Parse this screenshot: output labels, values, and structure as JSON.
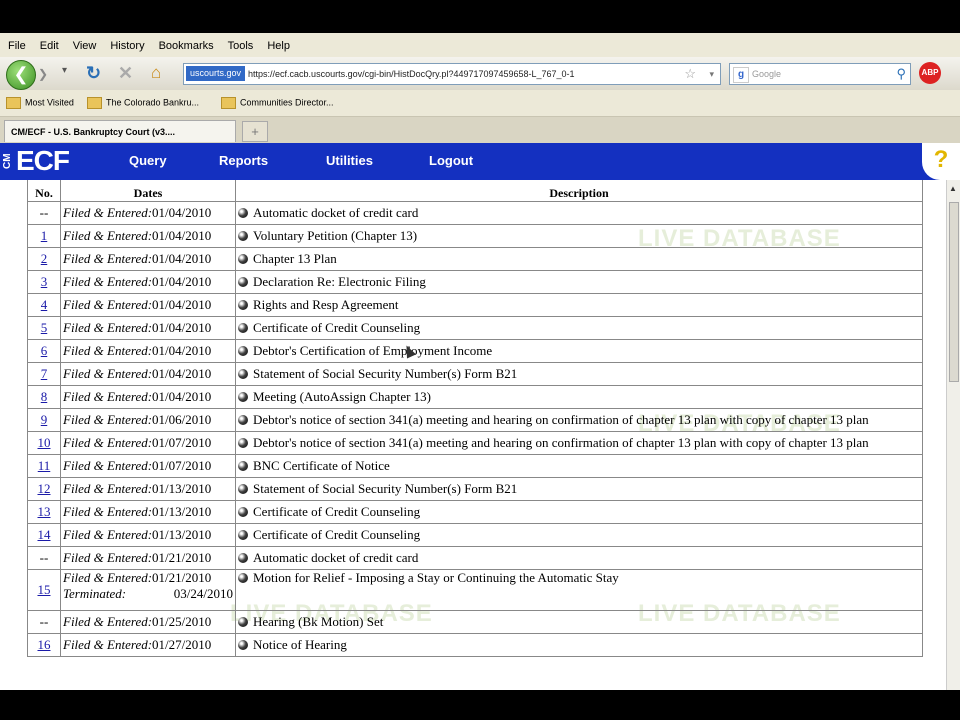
{
  "menu": [
    "File",
    "Edit",
    "View",
    "History",
    "Bookmarks",
    "Tools",
    "Help"
  ],
  "nav": {
    "back_icon": "back-arrow",
    "url_site": "uscourts.gov",
    "url": "https://ecf.cacb.uscourts.gov/cgi-bin/HistDocQry.pl?449717097459658-L_767_0-1",
    "search_placeholder": "Google",
    "adblock": "ABP"
  },
  "bookmarks": [
    "Most Visited",
    "The Colorado Bankru...",
    "Communities Director..."
  ],
  "tab": {
    "title": "CM/ECF - U.S. Bankruptcy Court (v3...."
  },
  "ecf": {
    "logo_cm": "CM",
    "logo_ecf": "ECF",
    "links": [
      "Query",
      "Reports",
      "Utilities",
      "Logout"
    ],
    "help": "?"
  },
  "watermark": "LIVE DATABASE",
  "table": {
    "headers": {
      "no": "No.",
      "dates": "Dates",
      "desc": "Description"
    },
    "filed_label": "Filed & Entered:",
    "terminated_label": "Terminated:",
    "rows": [
      {
        "no": "--",
        "date": "01/04/2010",
        "desc": "Automatic docket of credit card"
      },
      {
        "no": "1",
        "date": "01/04/2010",
        "desc": "Voluntary Petition (Chapter 13)"
      },
      {
        "no": "2",
        "date": "01/04/2010",
        "desc": "Chapter 13 Plan"
      },
      {
        "no": "3",
        "date": "01/04/2010",
        "desc": "Declaration Re: Electronic Filing"
      },
      {
        "no": "4",
        "date": "01/04/2010",
        "desc": "Rights and Resp Agreement"
      },
      {
        "no": "5",
        "date": "01/04/2010",
        "desc": "Certificate of Credit Counseling"
      },
      {
        "no": "6",
        "date": "01/04/2010",
        "desc": "Debtor's Certification of Employment Income"
      },
      {
        "no": "7",
        "date": "01/04/2010",
        "desc": "Statement of Social Security Number(s) Form B21"
      },
      {
        "no": "8",
        "date": "01/04/2010",
        "desc": "Meeting (AutoAssign Chapter 13)"
      },
      {
        "no": "9",
        "date": "01/06/2010",
        "desc": "Debtor's notice of section 341(a) meeting and hearing on confirmation of chapter 13 plan with copy of chapter 13 plan"
      },
      {
        "no": "10",
        "date": "01/07/2010",
        "desc": "Debtor's notice of section 341(a) meeting and hearing on confirmation of chapter 13 plan with copy of chapter 13 plan"
      },
      {
        "no": "11",
        "date": "01/07/2010",
        "desc": "BNC Certificate of Notice"
      },
      {
        "no": "12",
        "date": "01/13/2010",
        "desc": "Statement of Social Security Number(s) Form B21"
      },
      {
        "no": "13",
        "date": "01/13/2010",
        "desc": "Certificate of Credit Counseling"
      },
      {
        "no": "14",
        "date": "01/13/2010",
        "desc": "Certificate of Credit Counseling"
      },
      {
        "no": "--",
        "date": "01/21/2010",
        "desc": "Automatic docket of credit card"
      },
      {
        "no": "15",
        "date": "01/21/2010",
        "desc": "Motion for Relief - Imposing a Stay or Continuing the Automatic Stay",
        "terminated": "03/24/2010"
      },
      {
        "no": "--",
        "date": "01/25/2010",
        "desc": "Hearing (Bk Motion) Set"
      },
      {
        "no": "16",
        "date": "01/27/2010",
        "desc": "Notice of Hearing"
      }
    ]
  }
}
